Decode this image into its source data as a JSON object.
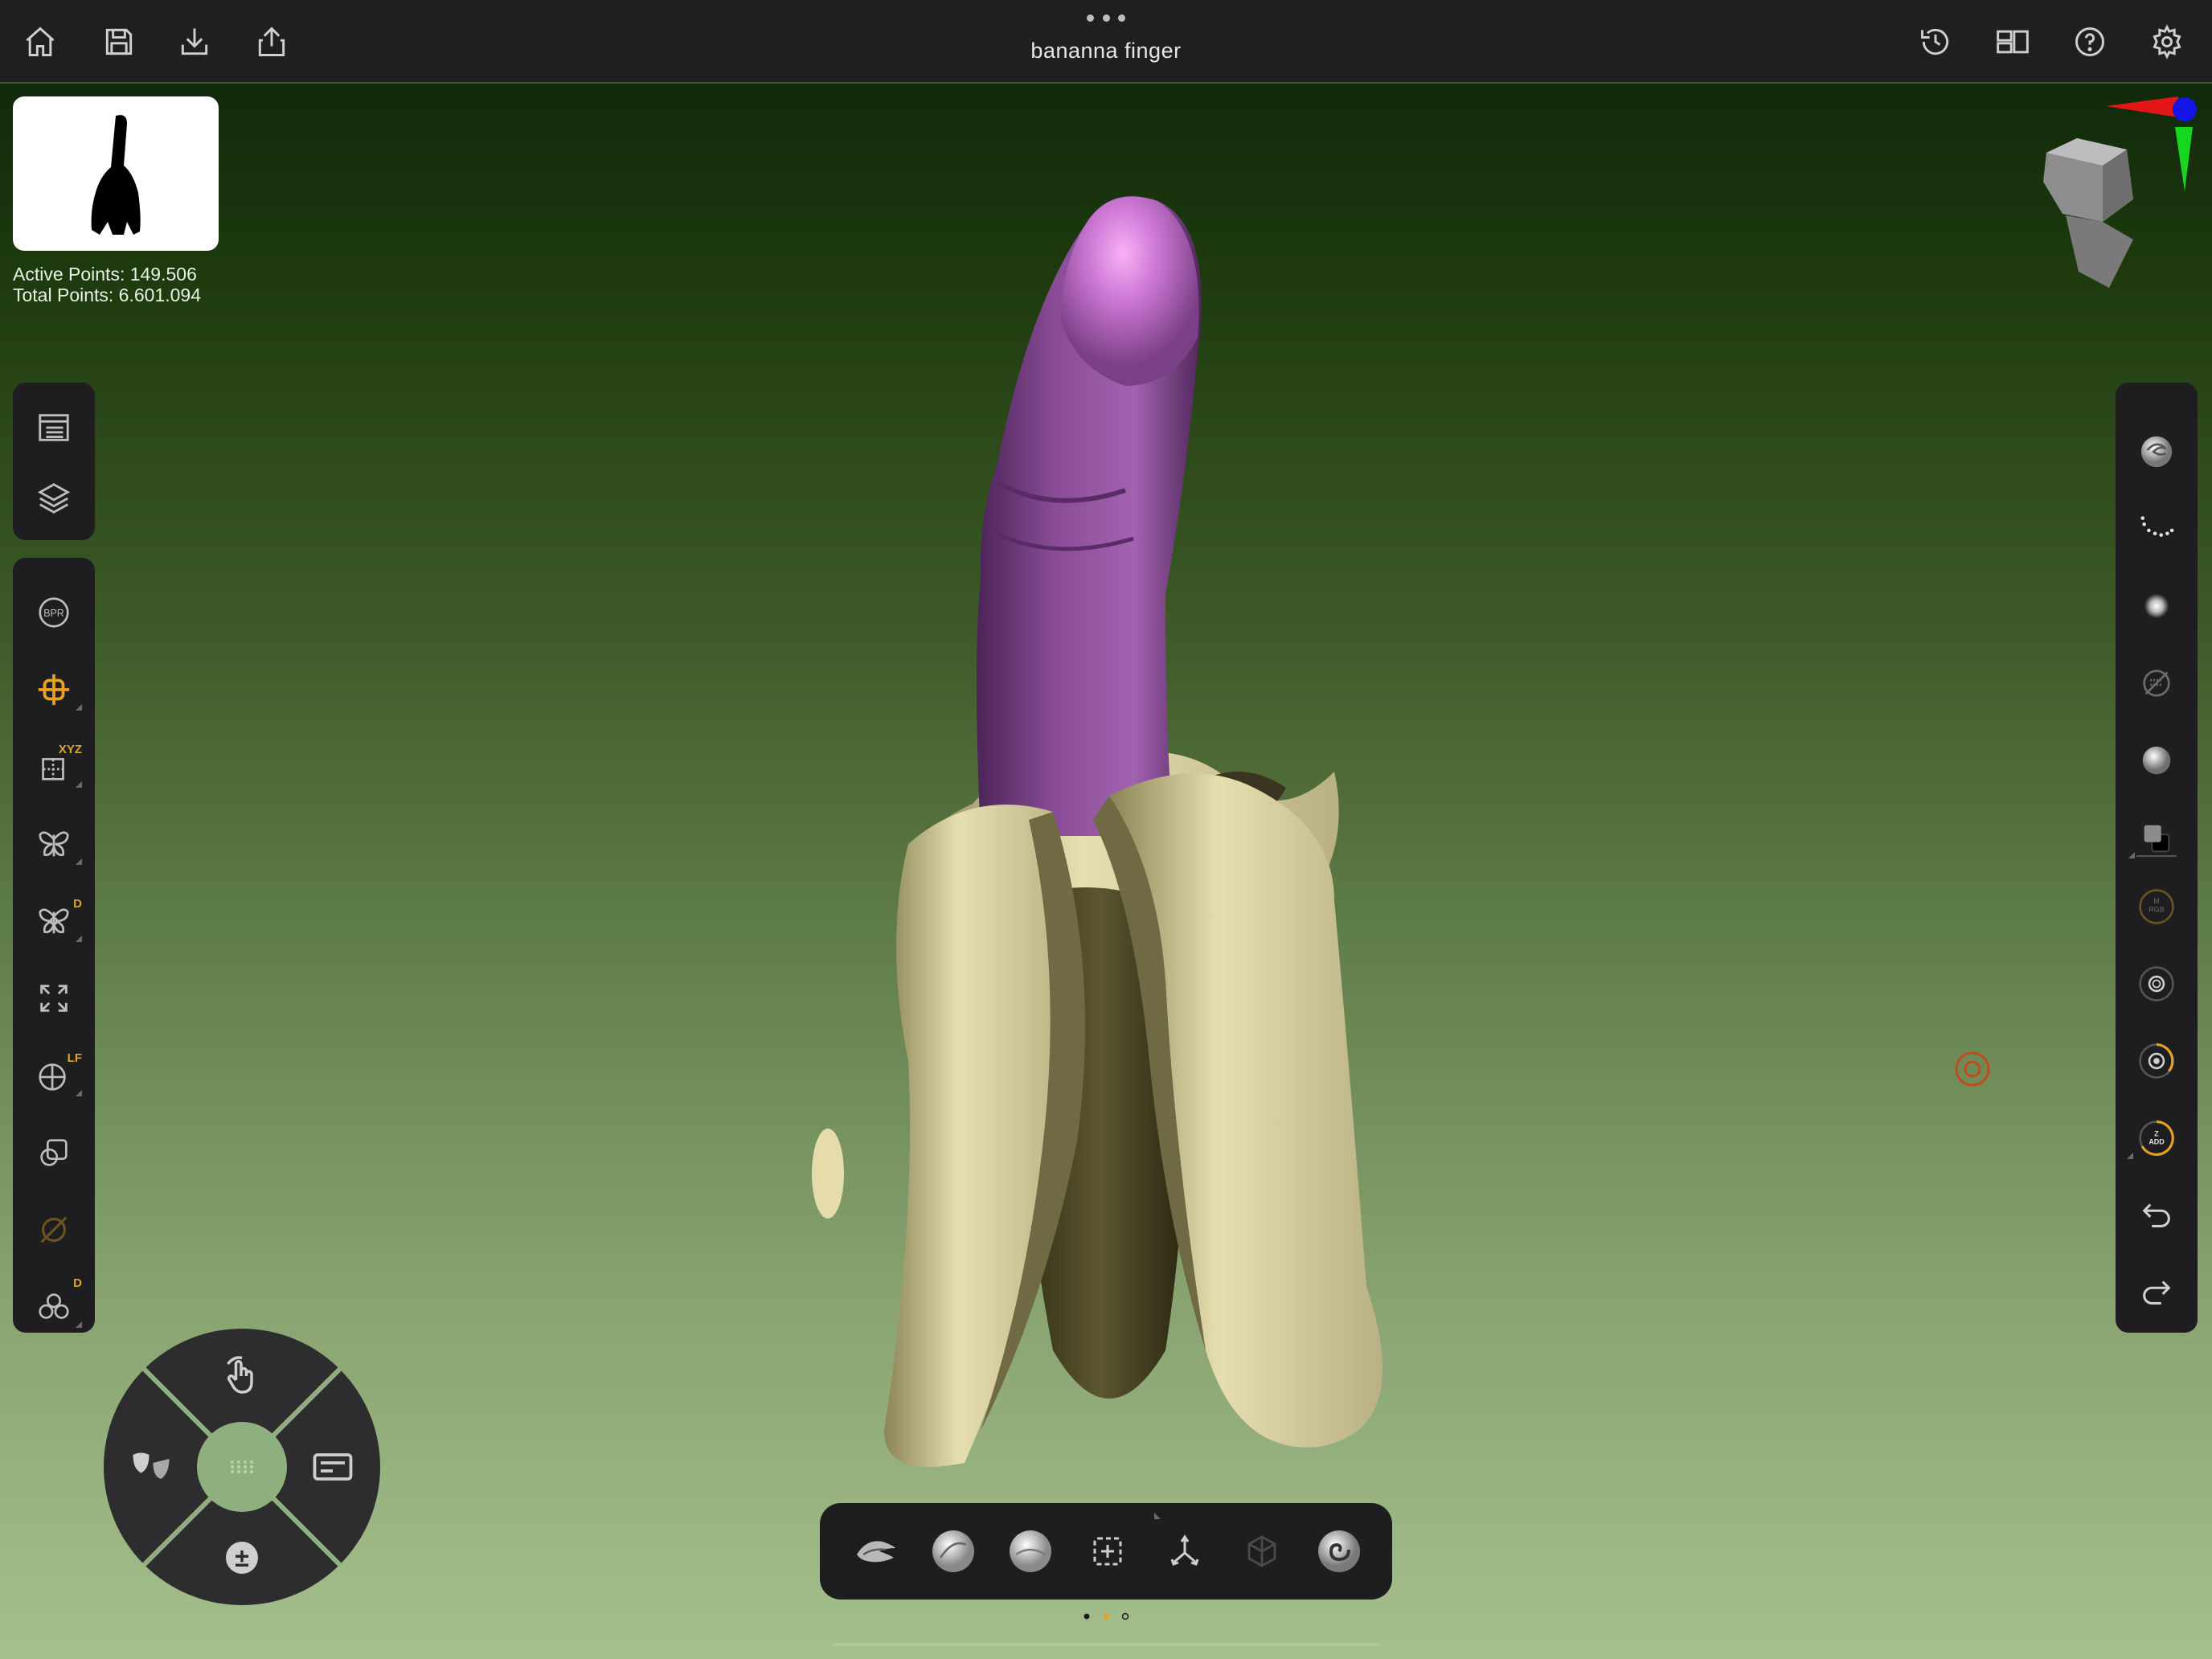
{
  "header": {
    "title": "bananna finger",
    "more_label": "more",
    "icons": {
      "home": "home-icon",
      "save": "save-icon",
      "import": "import-icon",
      "export": "share-icon",
      "history": "history-icon",
      "layout": "layout-icon",
      "help": "help-icon",
      "settings": "gear-icon"
    }
  },
  "stats": {
    "active": "Active Points: 149.506",
    "total": "Total Points: 6.601.094"
  },
  "left_tools": {
    "group1": [
      "subtool-list-icon",
      "layers-icon"
    ],
    "group2": [
      {
        "icon": "bpr-render-icon",
        "label": "BPR"
      },
      {
        "icon": "transform-gizmo-icon",
        "badge": ""
      },
      {
        "icon": "symmetry-xyz-icon",
        "badge": "XYZ"
      },
      {
        "icon": "mirror-butterfly-icon",
        "badge": ""
      },
      {
        "icon": "dynamic-symmetry-icon",
        "badge": "D"
      },
      {
        "icon": "fit-view-icon",
        "badge": ""
      },
      {
        "icon": "perspective-icon",
        "badge": "LF"
      },
      {
        "icon": "frame-icon",
        "badge": ""
      },
      {
        "icon": "disabled-brush-icon",
        "badge": ""
      },
      {
        "icon": "dynamesh-icon",
        "badge": "D"
      }
    ]
  },
  "right_tools": {
    "labels": {
      "mrgb": "M\nRGB",
      "zadd": "Z\nADD"
    },
    "icons": [
      "brush-icon",
      "stroke-icon",
      "alpha-icon",
      "texture-off-icon",
      "material-icon",
      "color-swatch-icon",
      "mrgb-icon",
      "focal-shift-icon",
      "intensity-icon",
      "zadd-icon",
      "undo-icon",
      "redo-icon"
    ]
  },
  "bottom_dock": {
    "icons": [
      "clay-brush-icon",
      "sphere-brush-icon",
      "smooth-brush-icon",
      "select-rect-icon",
      "transpose-icon",
      "mesh-icon",
      "spiral-brush-icon"
    ]
  },
  "wheel": {
    "icons": [
      "gesture-icon",
      "mask-icon",
      "palette-icon",
      "add-sub-icon",
      "grid-icon"
    ],
    "add_sub_label": "±"
  },
  "colors": {
    "panel": "#1e1e20",
    "accent": "#e8a020",
    "finger": "#8a4c96",
    "banana": "#e6dcab"
  }
}
